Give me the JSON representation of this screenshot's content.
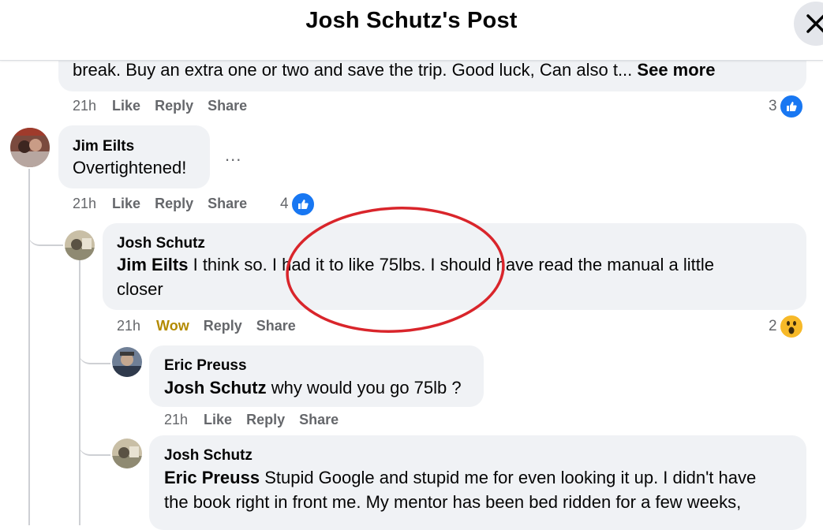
{
  "header": {
    "title": "Josh Schutz's Post"
  },
  "top_comment": {
    "text": "break. Buy an extra one or two and save the trip. Good luck, Can also t...",
    "see_more": "See more",
    "time": "21h",
    "like": "Like",
    "reply": "Reply",
    "share": "Share",
    "reaction_count": "3"
  },
  "comment_jim": {
    "author": "Jim Eilts",
    "text": "Overtightened!",
    "more": "...",
    "time": "21h",
    "like": "Like",
    "reply": "Reply",
    "share": "Share",
    "reaction_count": "4"
  },
  "reply_josh1": {
    "author": "Josh Schutz",
    "mention": "Jim Eilts",
    "line1": " I think so. I had it to like 75lbs. I should have read the manual a little",
    "line2": "closer",
    "time": "21h",
    "reaction_label": "Wow",
    "reply": "Reply",
    "share": "Share",
    "reaction_count": "2"
  },
  "reply_eric": {
    "author": "Eric Preuss",
    "mention": "Josh Schutz",
    "text": " why would you go 75lb ?",
    "time": "21h",
    "like": "Like",
    "reply": "Reply",
    "share": "Share"
  },
  "reply_josh2": {
    "author": "Josh Schutz",
    "mention": "Eric Preuss",
    "line1": " Stupid Google and stupid me for even looking it up. I didn't have",
    "line2": "the book right in front me. My mentor has been bed ridden for a few weeks,"
  },
  "colors": {
    "like_blue": "#1877f2",
    "wow_yellow": "#f7b928",
    "annotation_red": "#d9252b",
    "bubble_bg": "#f0f2f5"
  }
}
